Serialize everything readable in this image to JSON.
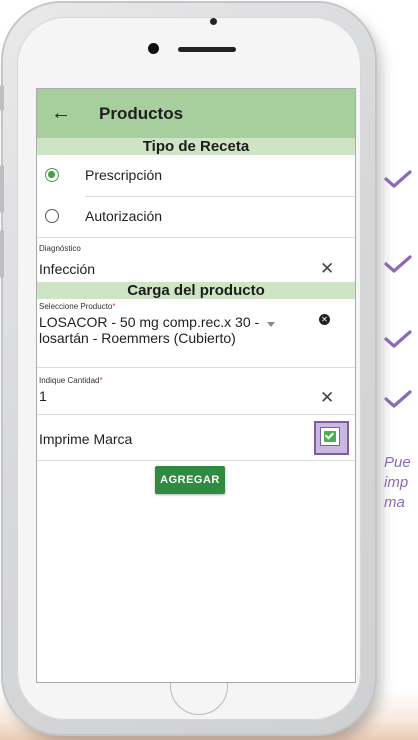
{
  "appbar": {
    "title": "Productos"
  },
  "tipo_receta": {
    "header": "Tipo de Receta",
    "options": [
      {
        "label": "Prescripción",
        "selected": true
      },
      {
        "label": "Autorización",
        "selected": false
      }
    ]
  },
  "diagnostico": {
    "label": "Diagnóstico",
    "value": "Infección"
  },
  "carga": {
    "header": "Carga del producto"
  },
  "producto": {
    "label": "Seleccione Producto",
    "required_mark": "*",
    "value_line1": "LOSACOR - 50 mg comp.rec.x 30 -",
    "value_line2": "losartán - Roemmers (Cubierto)"
  },
  "cantidad": {
    "label": "Indique Cantidad",
    "required_mark": "*",
    "value": "1"
  },
  "imprime": {
    "label": "Imprime Marca",
    "checked": true
  },
  "agregar_button": "AGREGAR",
  "annotation": {
    "line1": "Pue",
    "line2": "imp",
    "line3": "ma"
  },
  "colors": {
    "appbar": "#a7cf9e",
    "section": "#cde5c4",
    "button": "#2e8b3f",
    "accent": "#8b6bb8"
  }
}
